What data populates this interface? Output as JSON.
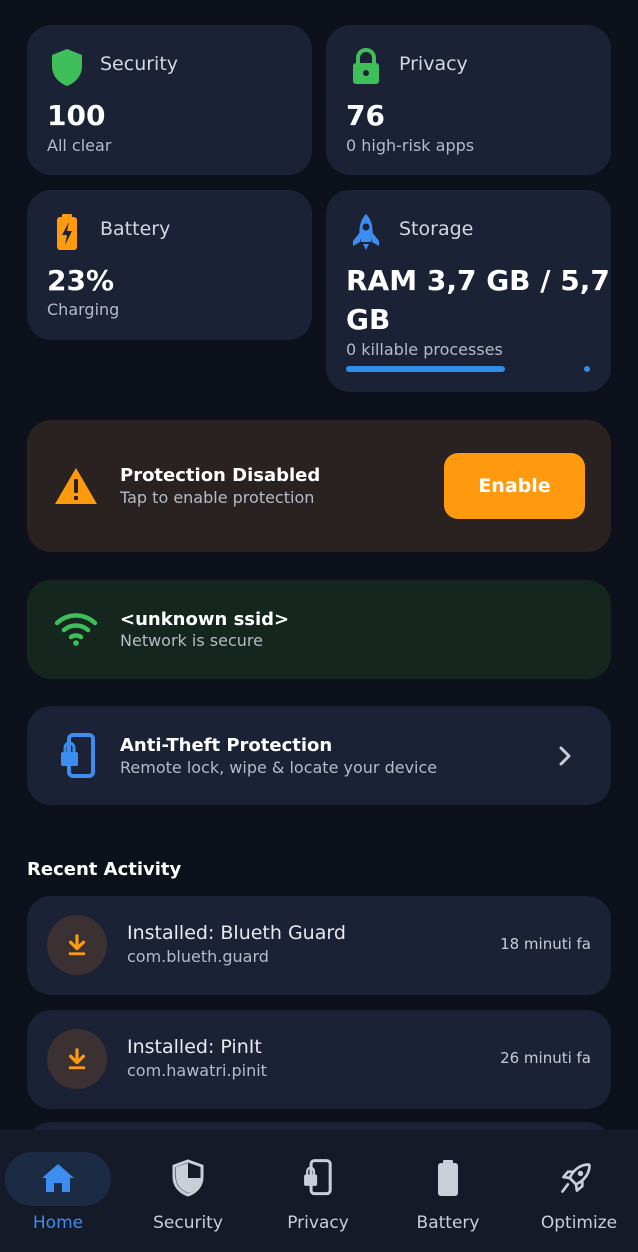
{
  "stats": {
    "security": {
      "title": "Security",
      "value": "100",
      "sub": "All clear",
      "icon": "shield-icon",
      "color": "#3fbf5a"
    },
    "privacy": {
      "title": "Privacy",
      "value": "76",
      "sub": "0 high-risk apps",
      "icon": "lock-icon",
      "color": "#3fbf5a"
    },
    "battery": {
      "title": "Battery",
      "value": "23%",
      "sub": "Charging",
      "icon": "battery-charging-icon",
      "color": "#ff9a0f"
    },
    "storage": {
      "title": "Storage",
      "value_line1": "RAM 3,7 GB / 5,7",
      "value_line2": "GB",
      "sub": "0 killable processes",
      "icon": "rocket-icon",
      "color": "#3d8cf0",
      "ram_usage_fraction": 0.65
    }
  },
  "protection_alert": {
    "title": "Protection Disabled",
    "sub": "Tap to enable protection",
    "button": "Enable",
    "icon": "warning-icon",
    "accent": "#ff9a0f"
  },
  "network": {
    "title": "<unknown ssid>",
    "sub": "Network is secure",
    "icon": "wifi-icon",
    "accent": "#3fbf5a"
  },
  "anti_theft": {
    "title": "Anti-Theft Protection",
    "sub": "Remote lock, wipe & locate your device",
    "icon": "phone-lock-icon",
    "accent": "#3d8cf0"
  },
  "recent_activity": {
    "title": "Recent Activity",
    "items": [
      {
        "title": "Installed: Blueth Guard",
        "package": "com.blueth.guard",
        "time": "18 minuti fa",
        "icon": "download-icon"
      },
      {
        "title": "Installed: PinIt",
        "package": "com.hawatri.pinit",
        "time": "26 minuti fa",
        "icon": "download-icon"
      }
    ]
  },
  "nav": {
    "items": [
      {
        "label": "Home",
        "icon": "home-icon",
        "active": true
      },
      {
        "label": "Security",
        "icon": "shield-icon",
        "active": false
      },
      {
        "label": "Privacy",
        "icon": "phone-lock-icon",
        "active": false
      },
      {
        "label": "Battery",
        "icon": "battery-icon",
        "active": false
      },
      {
        "label": "Optimize",
        "icon": "rocket-icon",
        "active": false
      }
    ]
  }
}
